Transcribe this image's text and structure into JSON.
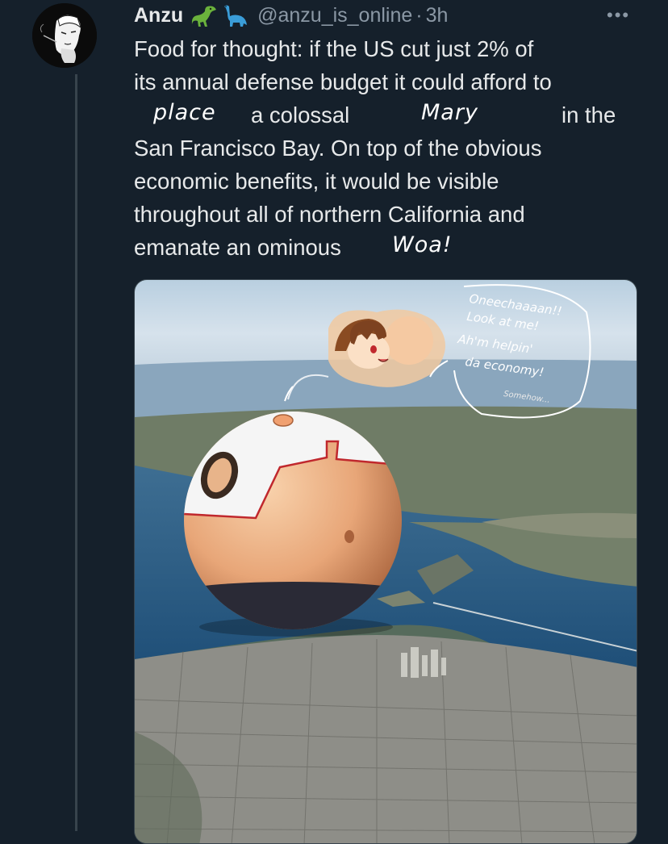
{
  "tweet": {
    "author_name": "Anzu",
    "emoji_icons": [
      "t-rex-icon",
      "sauropod-icon"
    ],
    "handle": "@anzu_is_online",
    "separator": "·",
    "time": "3h",
    "more_label": "•••",
    "lines": [
      "Food for thought: if the US cut just 2% of",
      "its annual defense budget it could afford to",
      "San Francisco Bay. On top of the obvious",
      "economic benefits, it would be visible",
      "throughout all of northern California and",
      "emanate an ominous"
    ],
    "line3": {
      "mid": "a colossal",
      "end": "in the"
    },
    "handwritten": {
      "word1": "place",
      "word2": "Mary",
      "word3": "Woa!"
    }
  },
  "image": {
    "speech_lines": [
      "Oneechaaaan!!",
      "Look at me!",
      "Ah'm helpin'",
      "da economy!"
    ],
    "speech_small": "Somehow..."
  },
  "colors": {
    "background": "#15202b",
    "text": "#e7e9ea",
    "muted": "#8b98a5",
    "thread_line": "#38444d"
  }
}
